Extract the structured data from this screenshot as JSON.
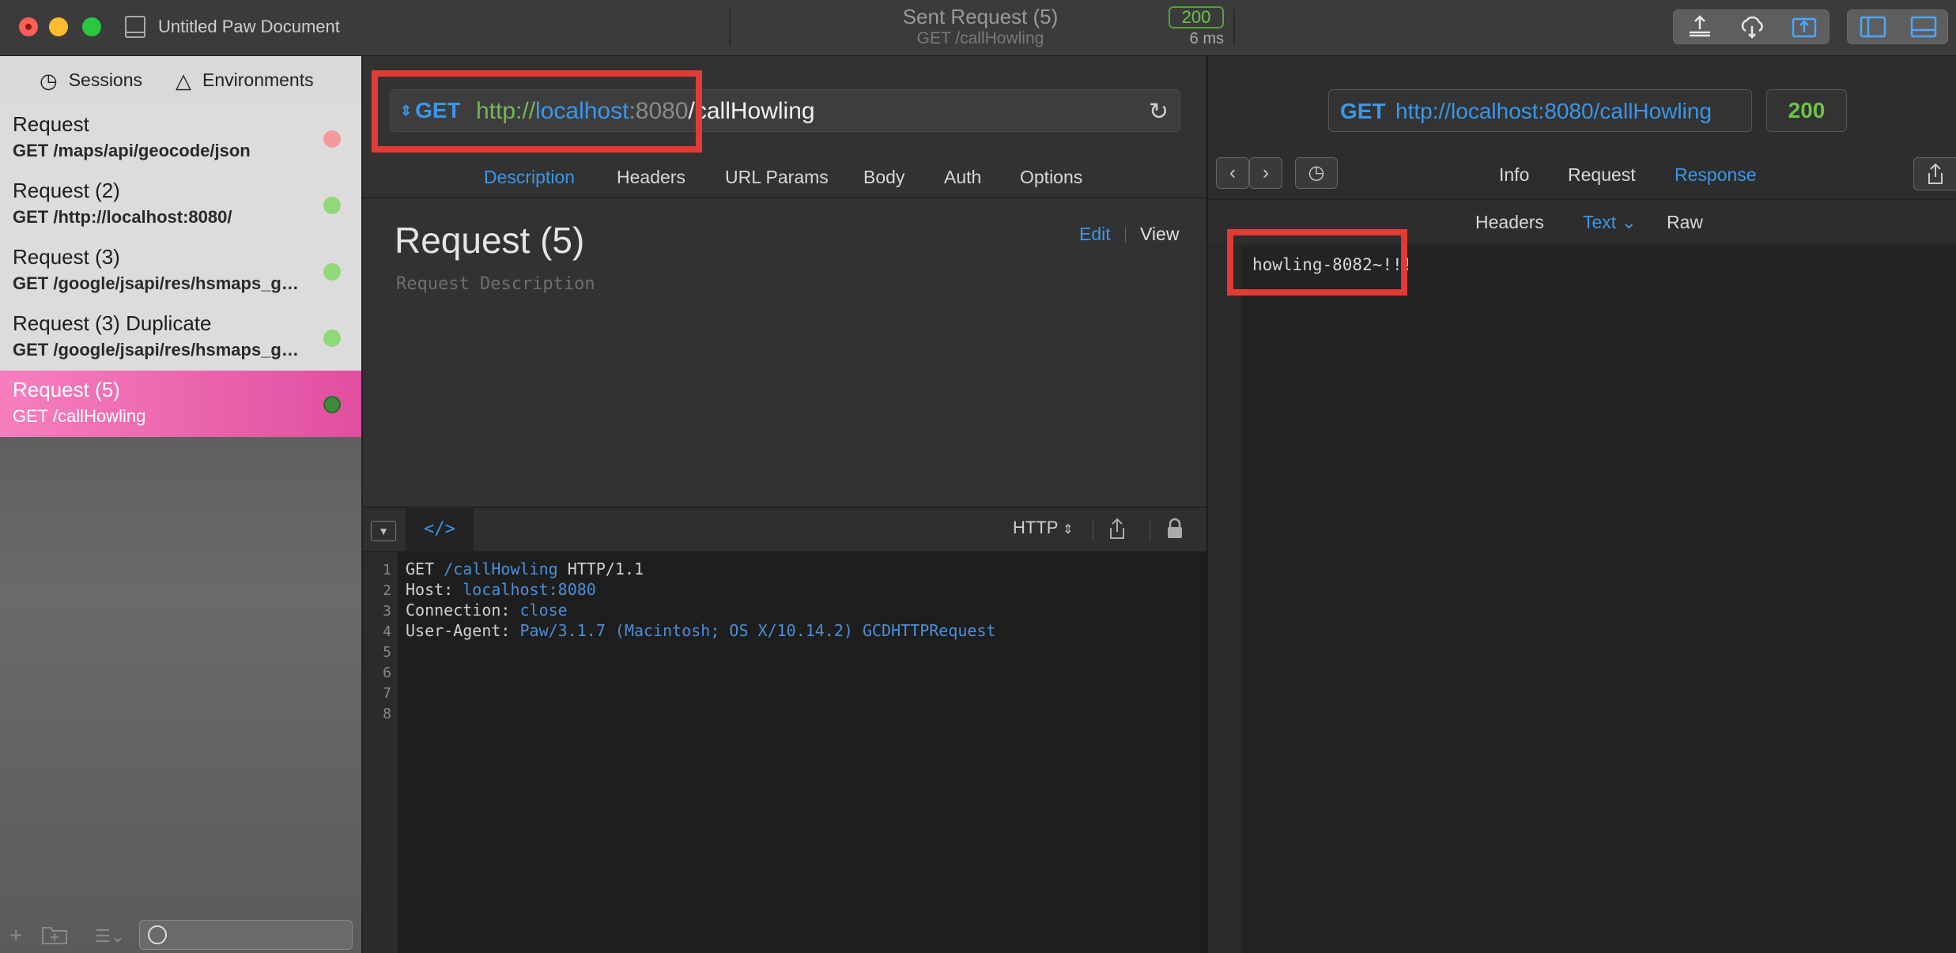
{
  "titlebar": {
    "doc_title": "Untitled Paw Document",
    "sent_title": "Sent Request (5)",
    "sent_subtitle": "GET /callHowling",
    "status_code": "200",
    "duration": "6 ms"
  },
  "sidebar": {
    "tabs": [
      {
        "label": "Sessions",
        "icon": "clock-icon"
      },
      {
        "label": "Environments",
        "icon": "environments-icon"
      }
    ],
    "requests": [
      {
        "name": "Request",
        "path": "GET /maps/api/geocode/json",
        "status": "error",
        "status_color": "#f59a9a"
      },
      {
        "name": "Request (2)",
        "path": "GET /http://localhost:8080/",
        "status": "ok",
        "status_color": "#90d878"
      },
      {
        "name": "Request (3)",
        "path": "GET /google/jsapi/res/hsmaps_go...",
        "status": "ok",
        "status_color": "#90d878"
      },
      {
        "name": "Request (3) Duplicate",
        "path": "GET /google/jsapi/res/hsmaps_go...",
        "status": "ok",
        "status_color": "#90d878"
      },
      {
        "name": "Request (5)",
        "path": "GET /callHowling",
        "status": "ok",
        "active": true,
        "status_color": "#3f8a3a"
      }
    ]
  },
  "request": {
    "method": "GET",
    "url_scheme": "http://",
    "url_host": "localhost",
    "url_port": ":8080",
    "url_path": "/callHowling",
    "tabs": [
      "Description",
      "Headers",
      "URL Params",
      "Body",
      "Auth",
      "Options"
    ],
    "selected_tab": "Description",
    "title": "Request (5)",
    "description_placeholder": "Request Description",
    "edit_label": "Edit",
    "view_label": "View"
  },
  "code_panel": {
    "code_toggle": "</>",
    "format": "HTTP",
    "line_numbers": [
      "1",
      "2",
      "3",
      "4",
      "5",
      "6",
      "7",
      "8"
    ],
    "lines": [
      {
        "a": "GET ",
        "b": "/callHowling",
        "c": " HTTP/1.1"
      },
      {
        "a": "Host: ",
        "b": "localhost:8080",
        "c": ""
      },
      {
        "a": "Connection: ",
        "b": "close",
        "c": ""
      },
      {
        "a": "User-Agent: ",
        "b": "Paw/3.1.7 (Macintosh; OS X/10.14.2) GCDHTTPRequest",
        "c": ""
      }
    ]
  },
  "response": {
    "method": "GET",
    "url": "http://localhost:8080/callHowling",
    "status_code": "200",
    "tabs": [
      "Info",
      "Request",
      "Response"
    ],
    "selected_tab": "Response",
    "sub_tabs": [
      "Headers",
      "Text ⌄",
      "Raw"
    ],
    "selected_sub_tab": "Text ⌄",
    "body": "howling-8082~!!!"
  },
  "colors": {
    "accent": "#3a97ea",
    "success": "#6fc14a",
    "highlight": "#e23a35",
    "active_item": "#e04f9f"
  }
}
